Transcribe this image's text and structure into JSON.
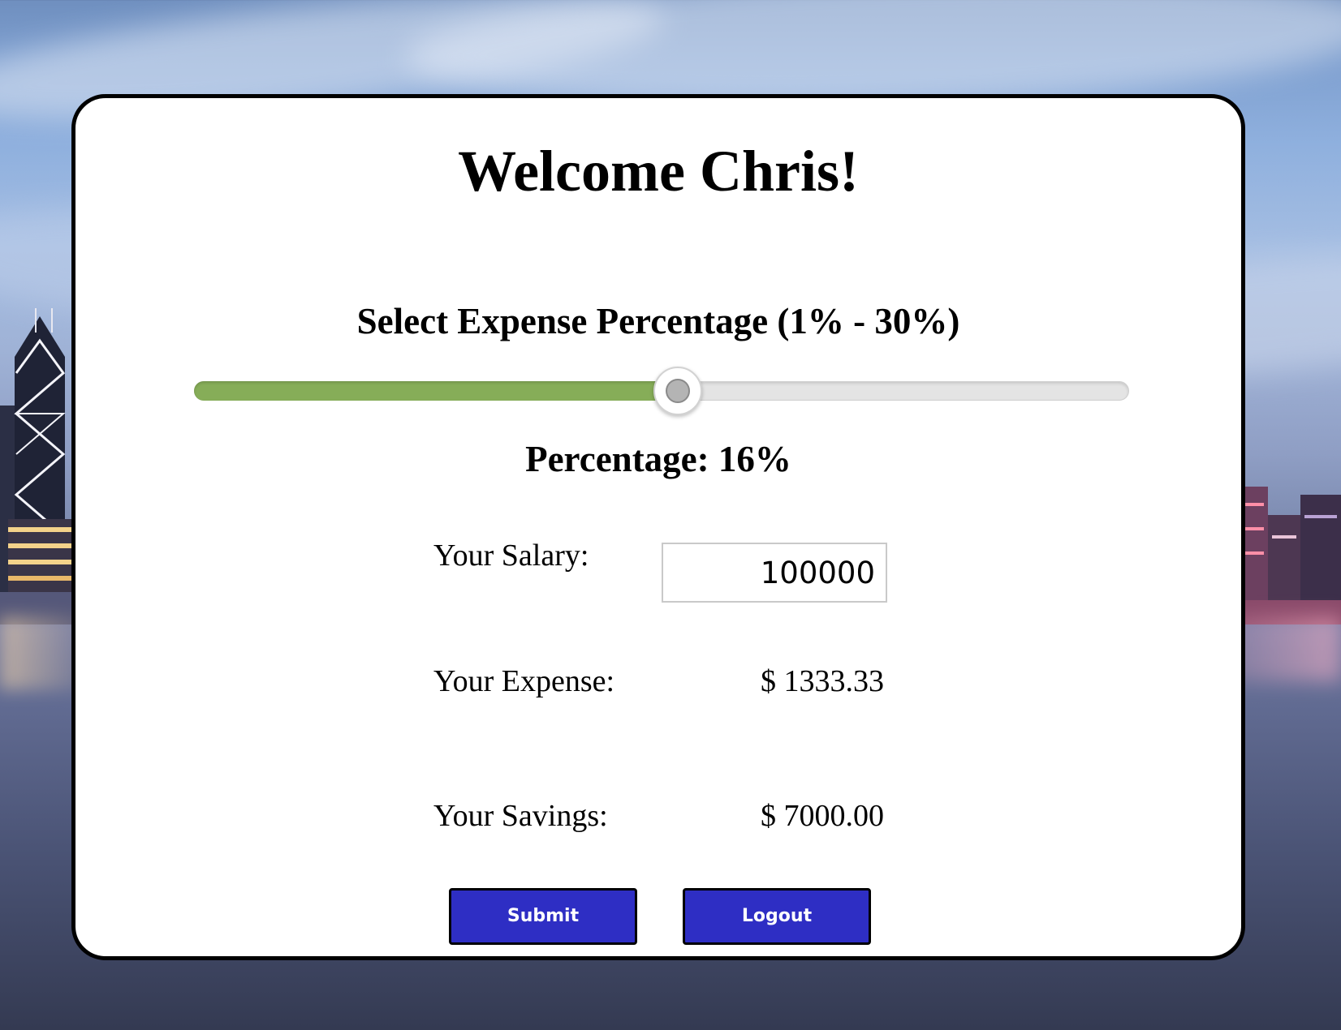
{
  "page": {
    "welcome_title": "Welcome Chris!"
  },
  "expense_slider": {
    "heading": "Select Expense Percentage (1% - 30%)",
    "min": 1,
    "max": 30,
    "value": 16,
    "fill_color": "#86ad58",
    "track_color": "#e4e4e4"
  },
  "percentage_display": {
    "text": "Percentage: 16%"
  },
  "fields": {
    "salary_label": "Your Salary:",
    "salary_value": "100000",
    "expense_label": "Your Expense:",
    "expense_value": "$ 1333.33",
    "savings_label": "Your Savings:",
    "savings_value": "$ 7000.00"
  },
  "actions": {
    "submit_label": "Submit",
    "logout_label": "Logout",
    "button_color": "#2e2ec4"
  }
}
